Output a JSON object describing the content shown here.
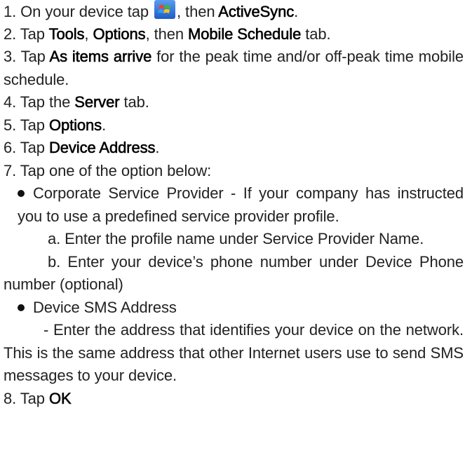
{
  "steps": {
    "s1": {
      "a": "1. On your device tap ",
      "b": ", then ",
      "c": "ActiveSync",
      "d": "."
    },
    "s2": {
      "a": "2. Tap ",
      "b": "Tools",
      "c": ", ",
      "d": "Options",
      "e": ", then ",
      "f": "Mobile Schedule",
      "g": " tab."
    },
    "s3": {
      "a": "3. Tap ",
      "b": "As items arrive",
      "c": " for the peak time and/or off-peak time mobile schedule."
    },
    "s4": {
      "a": "4. Tap the ",
      "b": "Server",
      "c": " tab."
    },
    "s5": {
      "a": "5. Tap ",
      "b": "Options",
      "c": "."
    },
    "s6": {
      "a": "6. Tap ",
      "b": "Device Address",
      "c": "."
    },
    "s7": {
      "a": "7. Tap one of the option below:"
    },
    "bullet1": {
      "text": "Corporate Service Provider - If your company has instructed you to use a predefined service provider profile."
    },
    "sub_a": {
      "text": "a. Enter the profile name under Service Provider Name."
    },
    "sub_b": {
      "text": "b. Enter your device’s phone number under Device Phone number (optional)"
    },
    "bullet2": {
      "text": "Device SMS Address"
    },
    "bullet2_detail": {
      "text": "- Enter the address that identifies your device on the network. This is the same address that other Internet users use to send SMS messages to your device."
    },
    "s8": {
      "a": "8. Tap ",
      "b": "OK"
    }
  },
  "icons": {
    "start": "windows-start-icon"
  },
  "colors": {
    "text": "#222222",
    "bold_text": "#000000",
    "icon_blue": "#2e6fd6",
    "icon_red": "#e8452c",
    "icon_green": "#3bb54a",
    "icon_yellow": "#f5c21b"
  }
}
